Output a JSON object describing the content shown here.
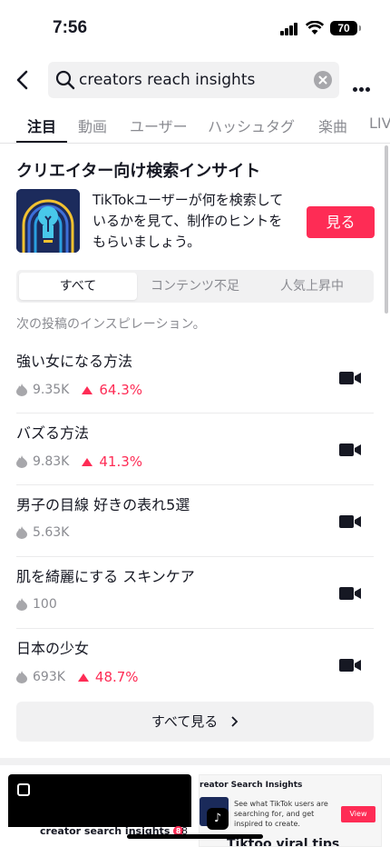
{
  "status": {
    "time": "7:56",
    "battery": "70"
  },
  "search": {
    "query": "creators reach insights"
  },
  "tabs": [
    "注目",
    "動画",
    "ユーザー",
    "ハッシュタグ",
    "楽曲",
    "LIVE"
  ],
  "insight": {
    "title": "クリエイター向け検索インサイト",
    "description": "TikTokユーザーが何を検索しているかを見て、制作のヒントをもらいましょう。",
    "button": "見る"
  },
  "segments": [
    "すべて",
    "コンテンツ不足",
    "人気上昇中"
  ],
  "caption": "次の投稿のインスピレーション。",
  "rows": [
    {
      "title": "強い女になる方法",
      "views": "9.35K",
      "growth": "64.3%"
    },
    {
      "title": "バズる方法",
      "views": "9.83K",
      "growth": "41.3%"
    },
    {
      "title": "男子の目線 好きの表れ5選",
      "views": "5.63K",
      "growth": ""
    },
    {
      "title": "肌を綺麗にする スキンケア",
      "views": "100",
      "growth": ""
    },
    {
      "title": "日本の少女",
      "views": "693K",
      "growth": "48.7%"
    }
  ],
  "see_all": "すべて見る",
  "bottom": {
    "thumb1_caption": "creator search insights",
    "thumb1_badge": "8",
    "thumb1_side": "8",
    "thumb2_title": "reator Search Insights",
    "thumb2_desc": "See what TikTok users are searching for, and get inspired to create.",
    "thumb2_button": "View",
    "thumb2_big": "Tiktoo viral tips"
  },
  "colors": {
    "accent": "#fe2c55",
    "muted": "#8a8b91"
  }
}
